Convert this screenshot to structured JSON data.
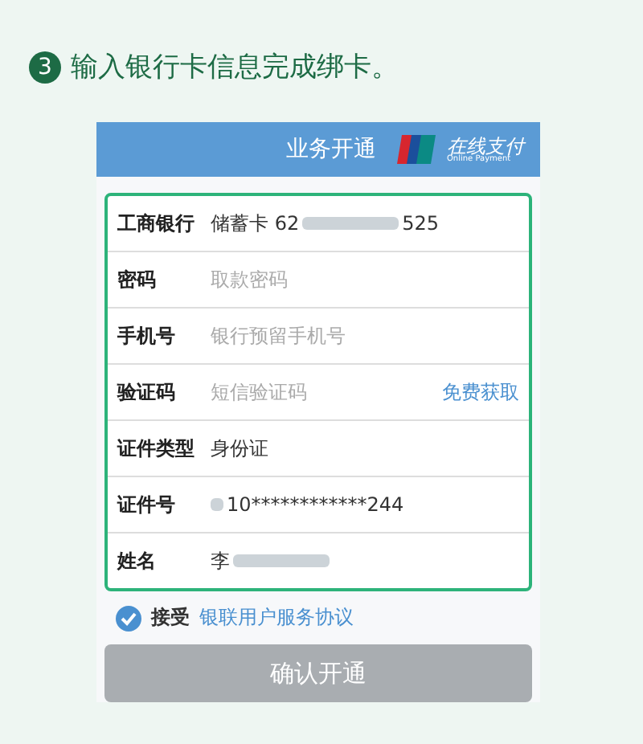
{
  "heading": {
    "step": "3",
    "text": "输入银行卡信息完成绑卡。"
  },
  "header": {
    "title": "业务开通",
    "logo_text": "在线支付",
    "logo_subtext": "Online Payment"
  },
  "rows": [
    {
      "label": "工商银行",
      "kind": "value",
      "value": "储蓄卡 62",
      "masked_tail": "525"
    },
    {
      "label": "密码",
      "kind": "input",
      "placeholder": "取款密码"
    },
    {
      "label": "手机号",
      "kind": "input",
      "placeholder": "银行预留手机号"
    },
    {
      "label": "验证码",
      "kind": "input",
      "placeholder": "短信验证码",
      "action": "免费获取"
    },
    {
      "label": "证件类型",
      "kind": "value",
      "value": "身份证"
    },
    {
      "label": "证件号",
      "kind": "value",
      "value": "10************244",
      "masked_head": true
    },
    {
      "label": "姓名",
      "kind": "value",
      "value": "李",
      "masked_tail": ""
    }
  ],
  "agreement": {
    "checked": true,
    "text": "接受",
    "link": "银联用户服务协议"
  },
  "submit": {
    "label": "确认开通",
    "disabled": true
  }
}
